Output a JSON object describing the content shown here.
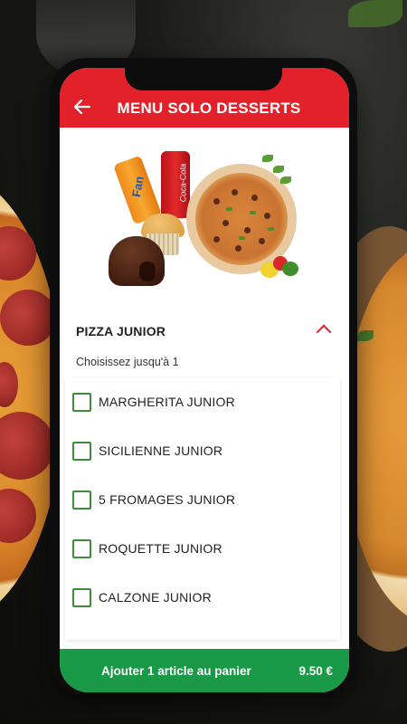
{
  "header": {
    "back_icon": "arrow-left-icon",
    "title": "MENU SOLO DESSERTS"
  },
  "hero": {
    "fanta_text": "Fan",
    "coke_text": "Coca-Cola"
  },
  "section": {
    "title": "PIZZA JUNIOR",
    "subtitle": "Choisissez jusqu'à 1",
    "toggle_icon": "chevron-up-icon",
    "options": [
      {
        "label": "MARGHERITA JUNIOR",
        "checked": false
      },
      {
        "label": "SICILIENNE JUNIOR",
        "checked": false
      },
      {
        "label": "5 FROMAGES JUNIOR",
        "checked": false
      },
      {
        "label": "ROQUETTE JUNIOR",
        "checked": false
      },
      {
        "label": "CALZONE JUNIOR",
        "checked": false
      }
    ]
  },
  "cart": {
    "label": "Ajouter 1 article au panier",
    "price": "9.50 €"
  },
  "colors": {
    "primary_red": "#e3212a",
    "cart_green": "#1a9947",
    "checkbox_green": "#3c8c3c"
  }
}
